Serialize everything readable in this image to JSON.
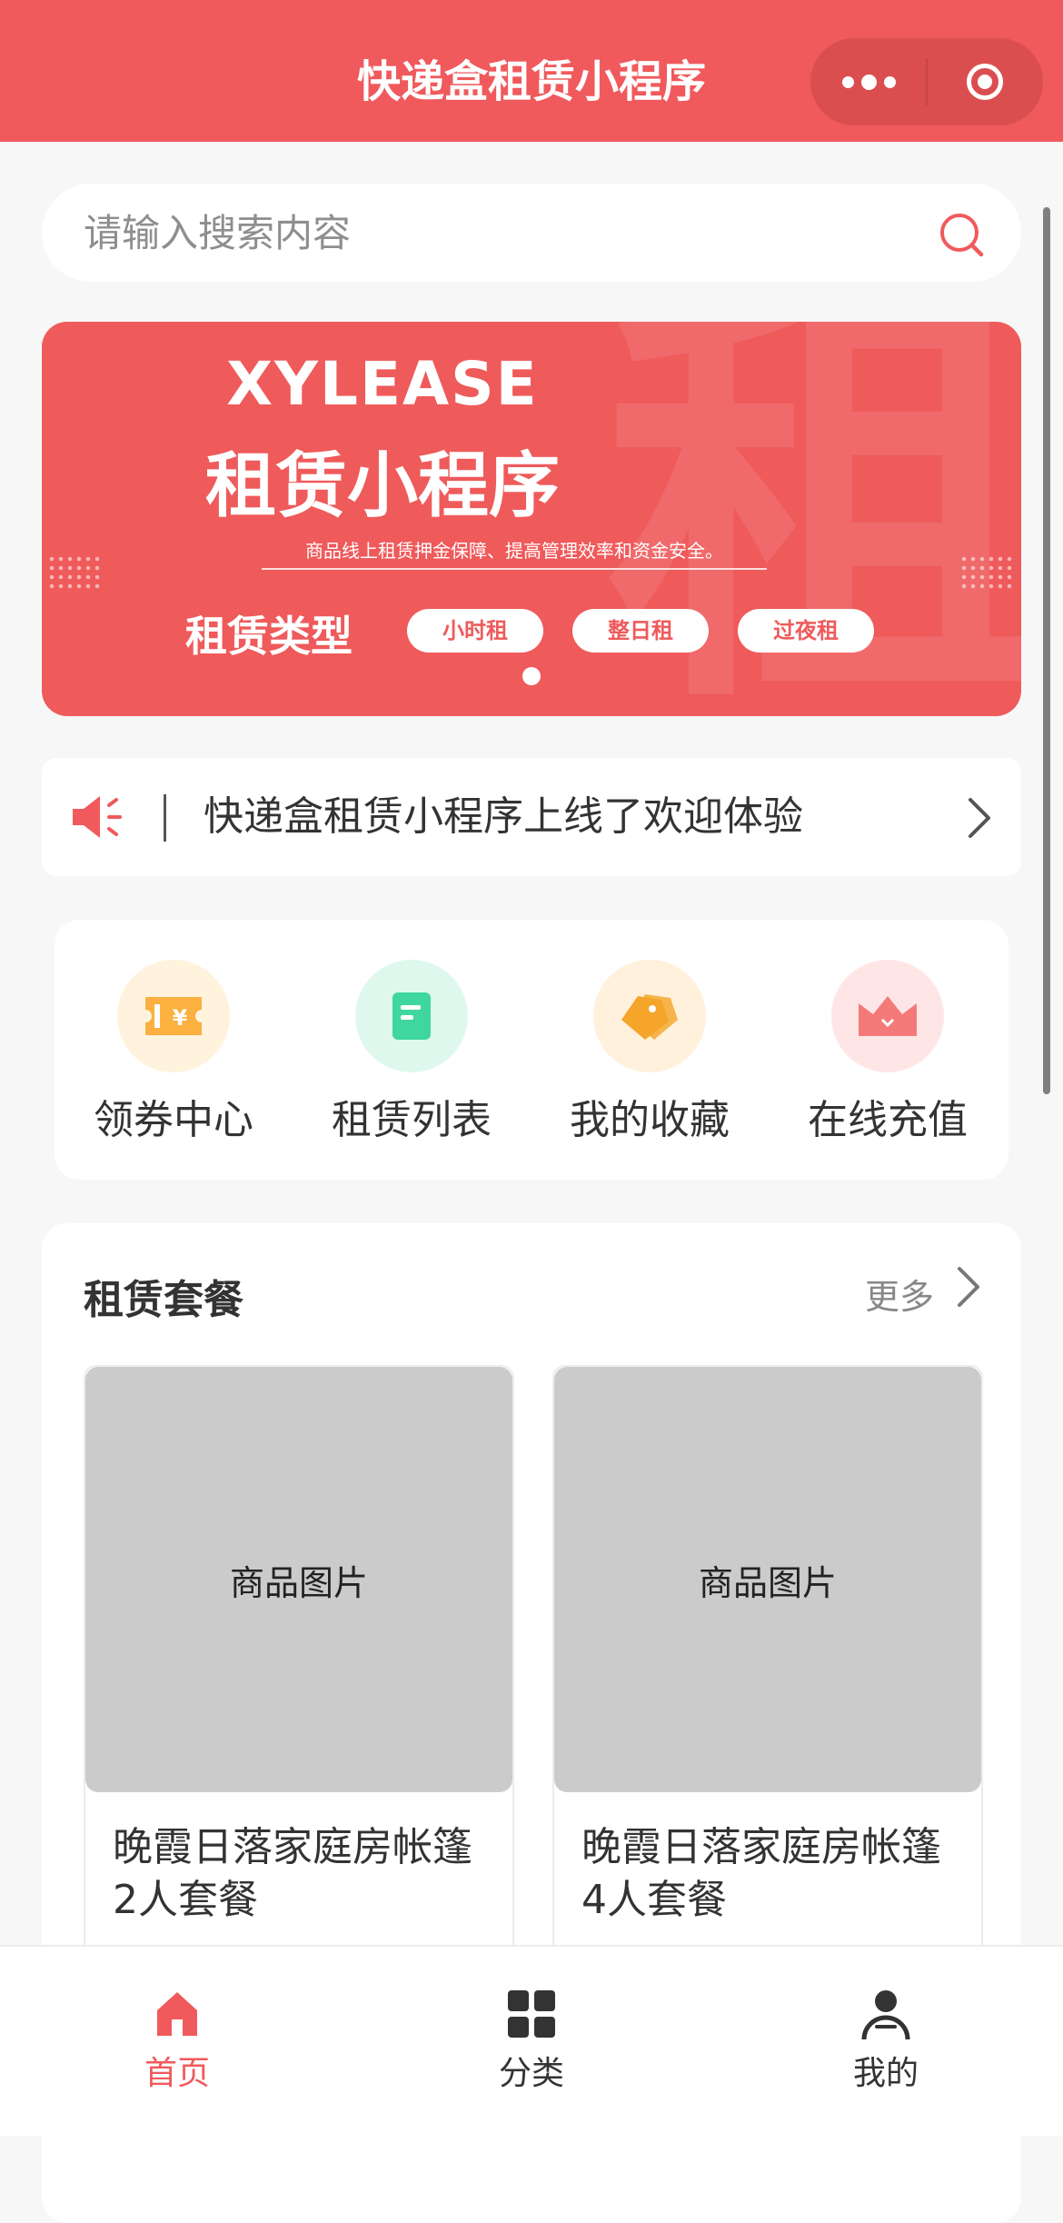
{
  "header": {
    "title": "快递盒租赁小程序"
  },
  "search": {
    "placeholder": "请输入搜索内容"
  },
  "banner": {
    "brand": "XYLEASE",
    "heading": "租赁小程序",
    "description": "商品线上租赁押金保障、提高管理效率和资金安全。",
    "type_label": "租赁类型",
    "tags": [
      "小时租",
      "整日租",
      "过夜租"
    ],
    "background_char": "租"
  },
  "notice": {
    "text": "快递盒租赁小程序上线了欢迎体验"
  },
  "quick_menu": {
    "items": [
      {
        "label": "领券中心",
        "icon": "coupon-icon",
        "bg": "#fff3dd",
        "color": "#f9a93a"
      },
      {
        "label": "租赁列表",
        "icon": "list-icon",
        "bg": "#dff8ee",
        "color": "#3fd6a0"
      },
      {
        "label": "我的收藏",
        "icon": "tag-icon",
        "bg": "#fff1dc",
        "color": "#f5a52a"
      },
      {
        "label": "在线充值",
        "icon": "wallet-icon",
        "bg": "#ffe6e6",
        "color": "#f47a7a"
      }
    ]
  },
  "packages": {
    "title": "租赁套餐",
    "more": "更多",
    "items": [
      {
        "image_label": "商品图片",
        "name": "晚霞日落家庭房帐篷2人套餐"
      },
      {
        "image_label": "商品图片",
        "name": "晚霞日落家庭房帐篷4人套餐"
      }
    ]
  },
  "tabbar": {
    "items": [
      {
        "label": "首页",
        "icon": "home-icon",
        "active": true
      },
      {
        "label": "分类",
        "icon": "grid-icon",
        "active": false
      },
      {
        "label": "我的",
        "icon": "user-icon",
        "active": false
      }
    ]
  },
  "colors": {
    "brand": "#f05a5c",
    "muted": "#888888",
    "placeholder": "#cbcbcb"
  }
}
